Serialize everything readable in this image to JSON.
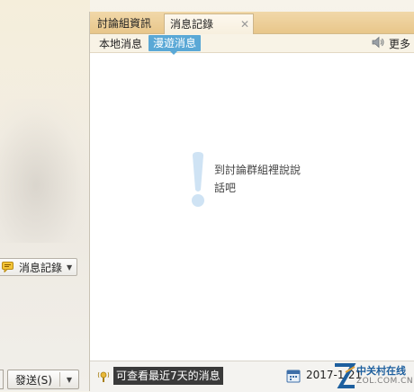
{
  "left": {
    "history_button": {
      "label": "消息記錄"
    },
    "send_button": {
      "label": "發送(S)"
    }
  },
  "panel": {
    "tabs": [
      {
        "label": "討論組資訊"
      },
      {
        "label": "消息記錄",
        "active": true,
        "close_icon": "close-icon"
      }
    ],
    "subtabs": [
      {
        "label": "本地消息"
      },
      {
        "label": "漫遊消息",
        "selected": true
      }
    ],
    "more": {
      "label": "更多",
      "icon": "speaker-icon"
    },
    "empty_state": {
      "icon": "exclamation-icon",
      "text": "到討論群組裡說說話吧"
    },
    "bottom": {
      "notice_icon": "info-icon",
      "notice_text": "可查看最近7天的消息",
      "calendar_icon": "calendar-icon",
      "date_text": "2017-1-21"
    },
    "watermark": {
      "title": "中关村在线",
      "sub": "ZOL.COM.CN"
    }
  },
  "colors": {
    "tabbar": "#e8c68a",
    "roaming_tab": "#5aa8d6",
    "empty_icon": "#cfe3f4"
  }
}
